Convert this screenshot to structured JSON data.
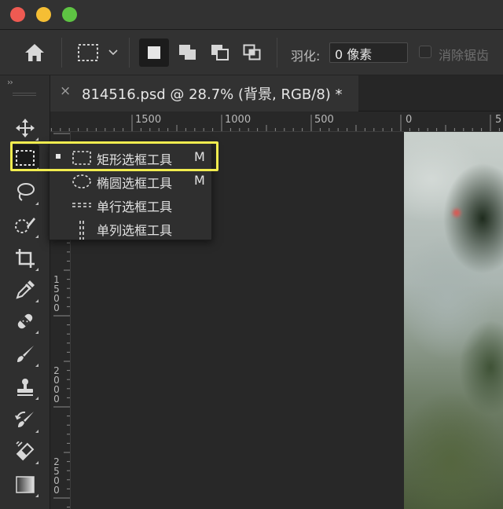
{
  "window": {
    "traffic_lights": [
      "close",
      "minimize",
      "maximize"
    ]
  },
  "options_bar": {
    "icons": {
      "home": "home-icon",
      "marquee_preset": "rect-marquee-icon",
      "preset_dropdown": "chevron-down-icon",
      "new_selection": "new-selection-icon",
      "add_selection": "add-to-selection-icon",
      "subtract_selection": "subtract-from-selection-icon",
      "intersect_selection": "intersect-selection-icon"
    },
    "feather_label": "羽化:",
    "feather_value": "0 像素",
    "antialias_label": "消除锯齿",
    "antialias_checked": false
  },
  "toolbar": {
    "collapse_glyph": "››",
    "tools": [
      {
        "name": "move-tool-icon"
      },
      {
        "name": "rect-marquee-tool-icon",
        "active": true
      },
      {
        "name": "lasso-tool-icon"
      },
      {
        "name": "quick-selection-tool-icon"
      },
      {
        "name": "crop-tool-icon"
      },
      {
        "name": "eyedropper-tool-icon"
      },
      {
        "name": "healing-brush-tool-icon"
      },
      {
        "name": "brush-tool-icon"
      },
      {
        "name": "clone-stamp-tool-icon"
      },
      {
        "name": "history-brush-tool-icon"
      },
      {
        "name": "eraser-tool-icon"
      },
      {
        "name": "gradient-tool-icon"
      }
    ]
  },
  "document_tab": {
    "close_glyph": "×",
    "title": "814516.psd @ 28.7% (背景, RGB/8) *"
  },
  "rulers": {
    "horizontal_labels": [
      "1500",
      "1000",
      "500",
      "0",
      "5"
    ],
    "vertical_labels": [
      "1\n5\n0\n0",
      "2\n0\n0\n0",
      "2\n5\n0\n0"
    ]
  },
  "marquee_flyout": {
    "items": [
      {
        "label": "矩形选框工具",
        "shortcut": "M",
        "current": true,
        "icon": "rect-marquee-icon"
      },
      {
        "label": "椭圆选框工具",
        "shortcut": "M",
        "current": false,
        "icon": "ellipse-marquee-icon"
      },
      {
        "label": "单行选框工具",
        "shortcut": "",
        "current": false,
        "icon": "single-row-marquee-icon"
      },
      {
        "label": "单列选框工具",
        "shortcut": "",
        "current": false,
        "icon": "single-column-marquee-icon"
      }
    ]
  },
  "colors": {
    "highlight_outline": "#f1ec4f",
    "panel": "#323232",
    "pasteboard": "#282828"
  }
}
